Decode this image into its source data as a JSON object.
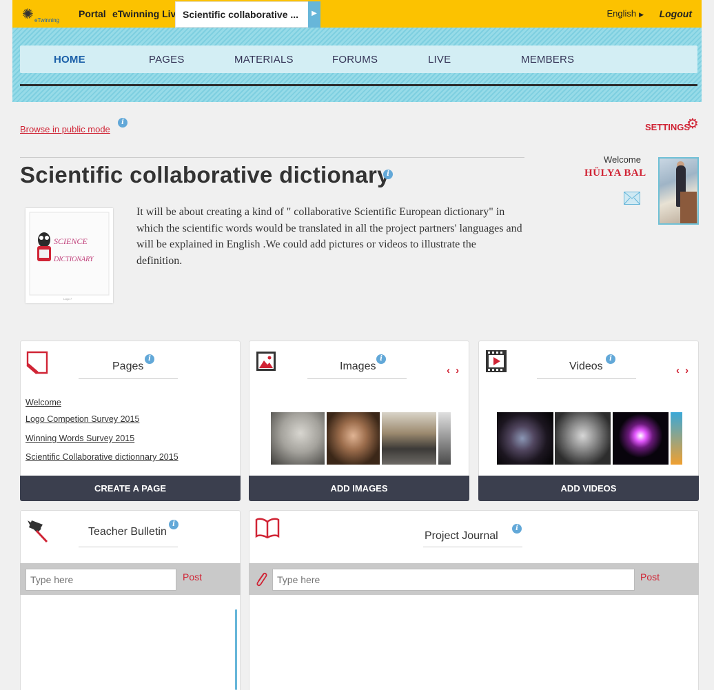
{
  "topbar": {
    "logo_text": "eTwinning",
    "portal": "Portal",
    "live": "eTwinning Live",
    "active_tab": "Scientific collaborative ...",
    "language": "English",
    "logout": "Logout",
    "colors": {
      "bar": "#fcc200",
      "accent": "#67b6d9"
    }
  },
  "nav": {
    "items": [
      "HOME",
      "PAGES",
      "MATERIALS",
      "FORUMS",
      "LIVE",
      "MEMBERS"
    ],
    "active": "HOME"
  },
  "header": {
    "browse_link": "Browse in public mode",
    "settings": "SETTINGS",
    "title": "Scientific collaborative dictionary",
    "welcome": "Welcome",
    "username": "HÜLYA BAL",
    "description": "It will be about creating a kind of \" collaborative Scientific European dictionary\" in which the scientific words would be translated in all the project partners' languages and will be explained in English .We could add pictures or videos to illustrate the definition."
  },
  "logo": {
    "line1": "SCIENCE",
    "line2": "DICTIONARY",
    "caption": "Logo 7"
  },
  "pages_card": {
    "title": "Pages",
    "links": [
      "Welcome",
      "Logo Competion Survey 2015",
      "Winning Words Survey 2015",
      "Scientific Collaborative dictionnary 2015"
    ],
    "button": "CREATE A PAGE"
  },
  "images_card": {
    "title": "Images",
    "arrows": "‹ ›",
    "button": "ADD IMAGES"
  },
  "videos_card": {
    "title": "Videos",
    "arrows": "‹ ›",
    "button": "ADD VIDEOS"
  },
  "bulletin_card": {
    "title": "Teacher Bulletin",
    "placeholder": "Type here",
    "post": "Post"
  },
  "journal_card": {
    "title": "Project Journal",
    "placeholder": "Type here",
    "post": "Post"
  },
  "colors": {
    "brand_red": "#d02435",
    "button_dark": "#3b3f4e",
    "info_blue": "#62a8d8"
  }
}
